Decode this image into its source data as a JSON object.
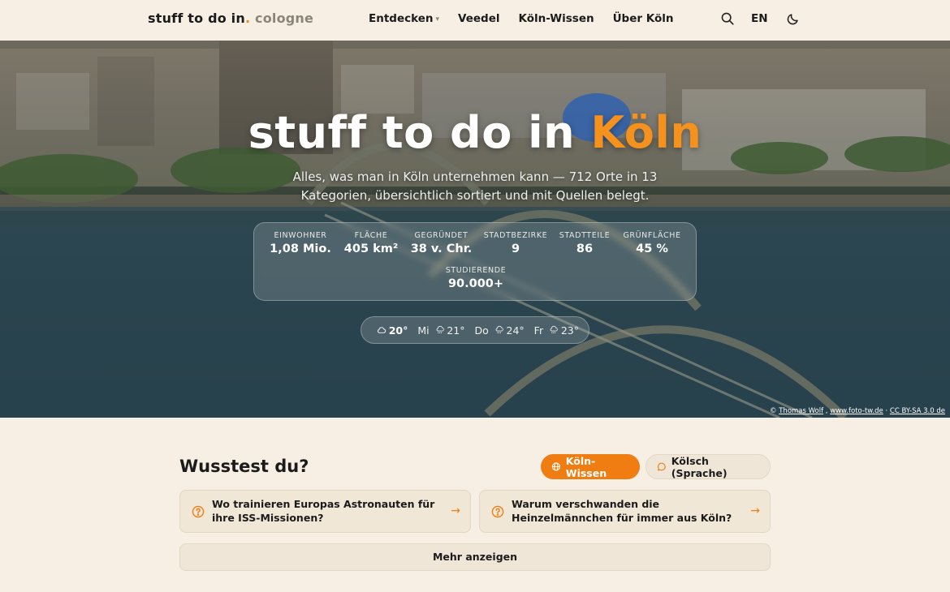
{
  "header": {
    "brand_main": "stuff to do in",
    "brand_dot": ".",
    "brand_city": "cologne",
    "nav": [
      {
        "label": "Entdecken",
        "has_caret": true
      },
      {
        "label": "Veedel"
      },
      {
        "label": "Köln-Wissen"
      },
      {
        "label": "Über Köln"
      }
    ],
    "caret_glyph": "▾",
    "lang": "EN",
    "icons": [
      "search-icon",
      "moon-icon"
    ]
  },
  "hero": {
    "title_main": "stuff to do in",
    "title_accent": "Köln",
    "subtitle": "Alles, was man in Köln unternehmen kann — 712 Orte in 13 Kategorien, übersichtlich sortiert und mit Quellen belegt.",
    "stats": [
      {
        "label": "Einwohner",
        "value": "1,08 Mio."
      },
      {
        "label": "Fläche",
        "value": "405 km²"
      },
      {
        "label": "Gegründet",
        "value": "38 v. Chr."
      },
      {
        "label": "Stadtbezirke",
        "value": "9"
      },
      {
        "label": "Stadtteile",
        "value": "86"
      },
      {
        "label": "Grünfläche",
        "value": "45 %"
      },
      {
        "label": "Studierende",
        "value": "90.000+"
      }
    ],
    "weather": {
      "now": "20°",
      "now_icon": "cloud-icon",
      "forecast": [
        {
          "day": "Mi",
          "temp": "21°",
          "icon": "rain-cloud-icon"
        },
        {
          "day": "Do",
          "temp": "24°",
          "icon": "rain-cloud-icon"
        },
        {
          "day": "Fr",
          "temp": "23°",
          "icon": "rain-cloud-icon"
        }
      ]
    },
    "credit": {
      "prefix": "© ",
      "author": "Thomas Wolf",
      "sep1": " , ",
      "site": "www.foto-tw.de",
      "sep2": " · ",
      "license": "CC BY-SA 3.0 de"
    }
  },
  "facts": {
    "title": "Wusstest du?",
    "tabs": [
      {
        "label": "Köln-Wissen",
        "active": true,
        "icon": "globe-icon"
      },
      {
        "label": "Kölsch (Sprache)",
        "active": false,
        "icon": "speech-bubble-icon"
      }
    ],
    "cards": [
      {
        "question": "Wo trainieren Europas Astronauten für ihre ISS-Missionen?"
      },
      {
        "question": "Warum verschwanden die Heinzelmännchen für immer aus Köln?"
      }
    ],
    "arrow": "→",
    "more_label": "Mehr anzeigen"
  },
  "colors": {
    "accent": "#f07d12",
    "background": "#f7efe3",
    "card": "#f1e7d7"
  }
}
